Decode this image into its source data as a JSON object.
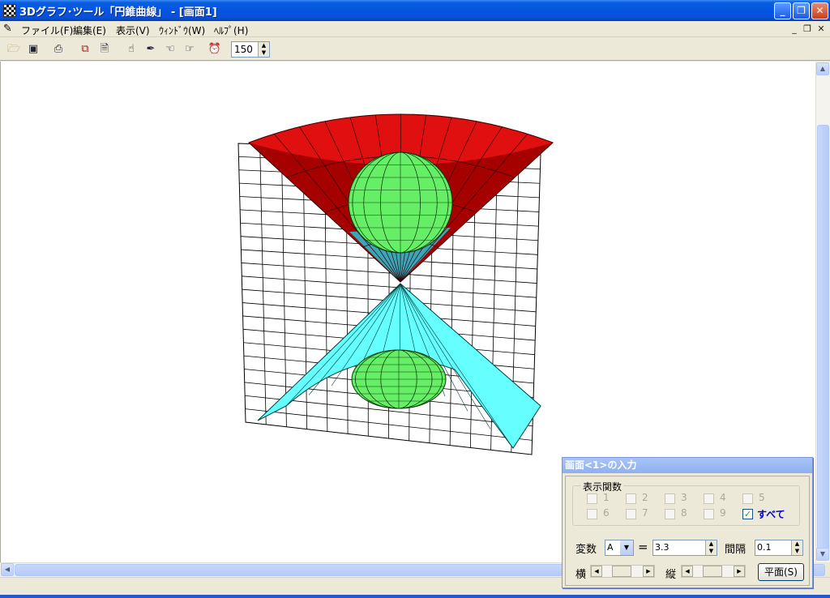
{
  "window": {
    "title": "3Dグラフ･ツール「円錐曲線」 - [画面1]",
    "minimize": "_",
    "restore": "❐",
    "close": "✕"
  },
  "menu": {
    "items": [
      "ファイル(F)",
      "編集(E)",
      "表示(V)",
      "ｳｨﾝﾄﾞｳ(W)",
      "ﾍﾙﾌﾟ(H)"
    ],
    "mdi_min": "_",
    "mdi_restore": "❐",
    "mdi_close": "✕"
  },
  "toolbar": {
    "zoom_value": "150",
    "icons": [
      "open-folder-icon",
      "save-disk-icon",
      "print-icon",
      "copy-icon",
      "document-icon",
      "pointer-hand-icon",
      "pen-icon",
      "hand-left-icon",
      "hand-right-icon",
      "alarm-clock-icon"
    ]
  },
  "scene": {
    "colors": {
      "upper_cone": "#e01010",
      "lower_cone": "#66ffff",
      "sphere": "#66ee66",
      "plane_grid": "#000000"
    }
  },
  "panel": {
    "title": "画面<1>の入力",
    "group_label": "表示関数",
    "functions": [
      {
        "label": "1",
        "checked": false
      },
      {
        "label": "2",
        "checked": false
      },
      {
        "label": "3",
        "checked": false
      },
      {
        "label": "4",
        "checked": false
      },
      {
        "label": "5",
        "checked": false
      },
      {
        "label": "6",
        "checked": false
      },
      {
        "label": "7",
        "checked": false
      },
      {
        "label": "8",
        "checked": false
      },
      {
        "label": "9",
        "checked": false
      },
      {
        "label": "すべて",
        "checked": true
      }
    ],
    "variable_label": "変数",
    "variable_value": "A",
    "equals": "=",
    "value": "3.3",
    "interval_label": "間隔",
    "interval_value": "0.1",
    "horizontal_label": "横",
    "vertical_label": "縦",
    "plane_button": "平面(S)"
  }
}
